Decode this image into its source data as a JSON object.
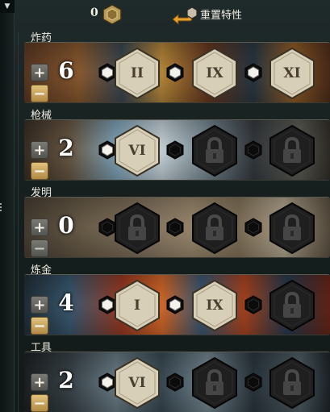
{
  "header": {
    "points_count": "0",
    "reset_label": "重置特性",
    "icons": {
      "points": "trait-point-hex-icon",
      "reset": "reset-arrow-icon"
    }
  },
  "colors": {
    "gold": "#d9b86c",
    "unlocked_hex": "#d8cfb8",
    "locked_hex": "#202020",
    "accent_orange": "#e0a030"
  },
  "lines": [
    {
      "title": "炸药",
      "rank": "6",
      "minus_enabled": true,
      "slots": [
        {
          "kind": "minor",
          "state": "unlocked"
        },
        {
          "kind": "major",
          "state": "unlocked",
          "label": "II"
        },
        {
          "kind": "minor",
          "state": "unlocked"
        },
        {
          "kind": "major",
          "state": "unlocked",
          "label": "IX"
        },
        {
          "kind": "minor",
          "state": "unlocked"
        },
        {
          "kind": "major",
          "state": "unlocked",
          "label": "XI"
        }
      ]
    },
    {
      "title": "枪械",
      "rank": "2",
      "minus_enabled": true,
      "slots": [
        {
          "kind": "minor",
          "state": "unlocked"
        },
        {
          "kind": "major",
          "state": "unlocked",
          "label": "VI"
        },
        {
          "kind": "minor",
          "state": "locked"
        },
        {
          "kind": "major",
          "state": "locked",
          "label": ""
        },
        {
          "kind": "minor",
          "state": "locked"
        },
        {
          "kind": "major",
          "state": "locked",
          "label": ""
        }
      ]
    },
    {
      "title": "发明",
      "rank": "0",
      "minus_enabled": false,
      "slots": [
        {
          "kind": "minor",
          "state": "locked"
        },
        {
          "kind": "major",
          "state": "locked",
          "label": ""
        },
        {
          "kind": "minor",
          "state": "locked"
        },
        {
          "kind": "major",
          "state": "locked",
          "label": ""
        },
        {
          "kind": "minor",
          "state": "locked"
        },
        {
          "kind": "major",
          "state": "locked",
          "label": ""
        }
      ]
    },
    {
      "title": "炼金",
      "rank": "4",
      "minus_enabled": true,
      "slots": [
        {
          "kind": "minor",
          "state": "unlocked"
        },
        {
          "kind": "major",
          "state": "unlocked",
          "label": "I"
        },
        {
          "kind": "minor",
          "state": "unlocked"
        },
        {
          "kind": "major",
          "state": "unlocked",
          "label": "IX"
        },
        {
          "kind": "minor",
          "state": "locked"
        },
        {
          "kind": "major",
          "state": "locked",
          "label": ""
        }
      ]
    },
    {
      "title": "工具",
      "rank": "2",
      "minus_enabled": true,
      "slots": [
        {
          "kind": "minor",
          "state": "unlocked"
        },
        {
          "kind": "major",
          "state": "unlocked",
          "label": "VI"
        },
        {
          "kind": "minor",
          "state": "locked"
        },
        {
          "kind": "major",
          "state": "locked",
          "label": ""
        },
        {
          "kind": "minor",
          "state": "locked"
        },
        {
          "kind": "major",
          "state": "locked",
          "label": ""
        }
      ]
    }
  ],
  "controls": {
    "plus_label": "+",
    "minus_label": "−"
  }
}
